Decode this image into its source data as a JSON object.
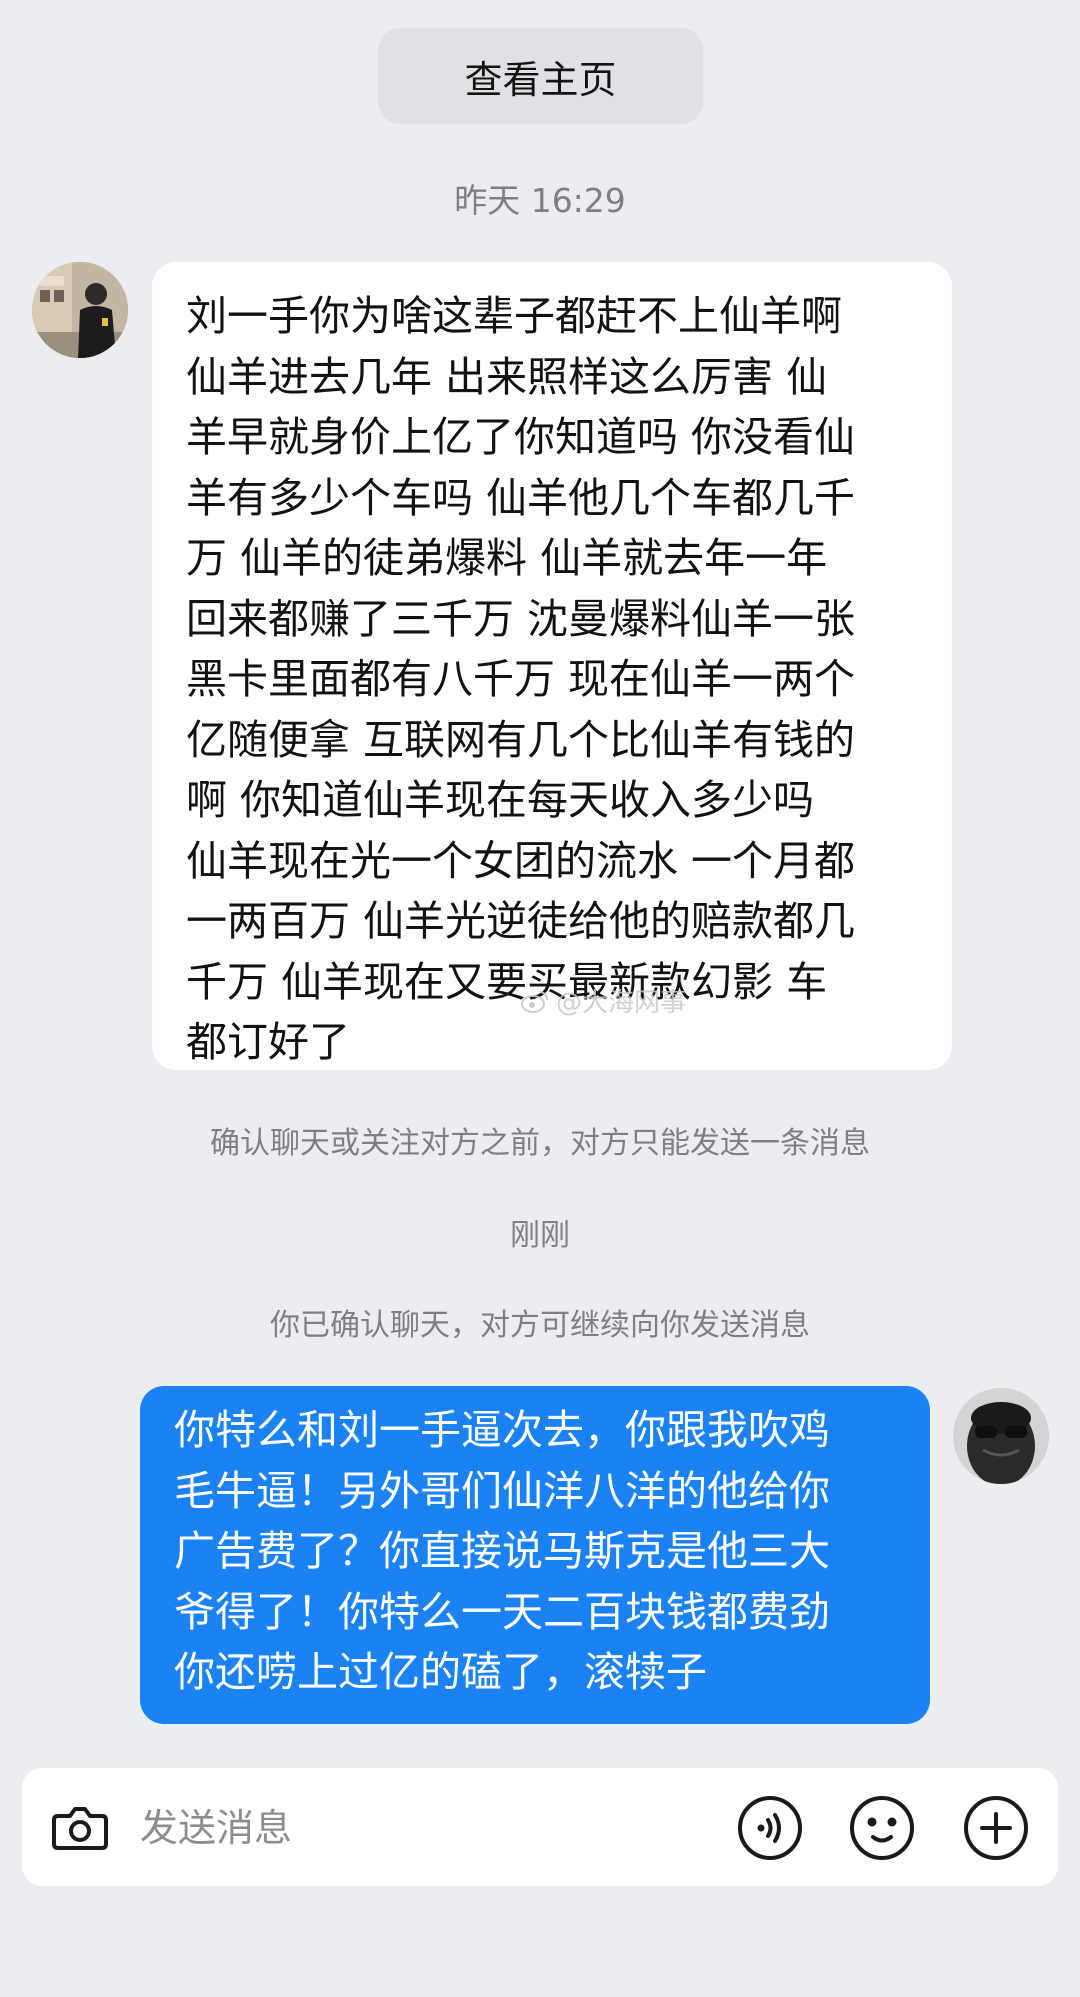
{
  "header": {
    "profile_button": "查看主页"
  },
  "messages": [
    {
      "direction": "incoming",
      "timestamp": "昨天 16:29",
      "text": "刘一手你为啥这辈子都赶不上仙羊啊\n仙羊进去几年 出来照样这么厉害 仙\n羊早就身价上亿了你知道吗 你没看仙\n羊有多少个车吗 仙羊他几个车都几千\n万 仙羊的徒弟爆料 仙羊就去年一年\n回来都赚了三千万 沈曼爆料仙羊一张\n黑卡里面都有八千万 现在仙羊一两个\n亿随便拿 互联网有几个比仙羊有钱的\n啊 你知道仙羊现在每天收入多少吗\n仙羊现在光一个女团的流水 一个月都\n一两百万 仙羊光逆徒给他的赔款都几\n千万 仙羊现在又要买最新款幻影 车\n都订好了"
    },
    {
      "direction": "outgoing",
      "timestamp": "刚刚",
      "text": "你特么和刘一手逼次去，你跟我吹鸡\n毛牛逼！另外哥们仙洋八洋的他给你\n广告费了？你直接说马斯克是他三大\n爷得了！你特么一天二百块钱都费劲\n你还唠上过亿的磕了，滚犊子"
    }
  ],
  "system_notices": {
    "limit_notice": "确认聊天或关注对方之前，对方只能发送一条消息",
    "confirmed_notice": "你已确认聊天，对方可继续向你发送消息"
  },
  "watermark": "@大海网事",
  "input_bar": {
    "placeholder": "发送消息",
    "icons": [
      "camera-icon",
      "voice-icon",
      "emoji-icon",
      "plus-icon"
    ]
  },
  "colors": {
    "background": "#ecedf0",
    "outgoing_bubble": "#1a82f4",
    "incoming_bubble": "#ffffff",
    "meta_text": "#7d7f85"
  }
}
